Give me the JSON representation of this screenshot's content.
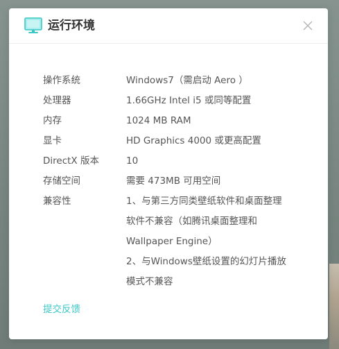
{
  "dialog": {
    "title": "运行环境",
    "icon": "monitor-icon",
    "close_icon": "close-icon"
  },
  "specs": [
    {
      "label": "操作系统",
      "lines": [
        "Windows7（需启动 Aero ）"
      ]
    },
    {
      "label": "处理器",
      "lines": [
        "1.66GHz Intel i5 或同等配置"
      ]
    },
    {
      "label": "内存",
      "lines": [
        "1024 MB RAM"
      ]
    },
    {
      "label": "显卡",
      "lines": [
        "HD Graphics 4000 或更高配置"
      ]
    },
    {
      "label": "DirectX 版本",
      "lines": [
        "10"
      ]
    },
    {
      "label": "存储空间",
      "lines": [
        "需要 473MB 可用空间"
      ]
    },
    {
      "label": "兼容性",
      "lines": [
        "1、与第三方同类壁纸软件和桌面整理",
        "软件不兼容（如腾讯桌面整理和",
        "Wallpaper Engine）",
        "2、与Windows壁纸设置的幻灯片播放",
        "模式不兼容"
      ]
    }
  ],
  "feedback_link": "提交反馈",
  "colors": {
    "accent": "#3cc7c7",
    "text": "#555555",
    "title": "#333333",
    "backdrop": "#7e8c88"
  }
}
